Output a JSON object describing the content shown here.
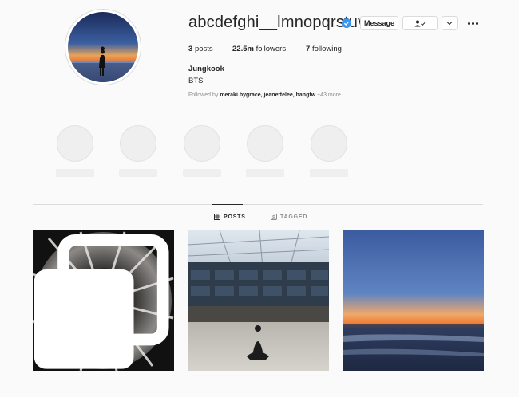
{
  "profile": {
    "username": "abcdefghi__lmnopqrstuv...",
    "verified": true,
    "message_label": "Message",
    "full_name": "Jungkook",
    "bio": "BTS",
    "stats": {
      "posts_count": "3",
      "posts_label": "posts",
      "followers_count": "22.5m",
      "followers_label": "followers",
      "following_count": "7",
      "following_label": "following"
    },
    "followed_by": {
      "prefix": "Followed by",
      "names": "meraki.bygrace,  jeanettelee, hangtw",
      "suffix": "+43 more"
    }
  },
  "tabs": {
    "posts": "POSTS",
    "tagged": "TAGGED"
  },
  "colors": {
    "background": "#fafafa",
    "border": "#dbdbdb",
    "verified_blue": "#3897f0",
    "text": "#262626",
    "muted": "#8e8e8e"
  },
  "icons": {
    "verified": "verified-badge-icon",
    "follow": "person-check-icon",
    "chevron": "chevron-down-icon",
    "more": "more-options-icon",
    "posts_tab": "grid-icon",
    "tagged_tab": "tag-icon",
    "multi_post": "carousel-icon"
  }
}
